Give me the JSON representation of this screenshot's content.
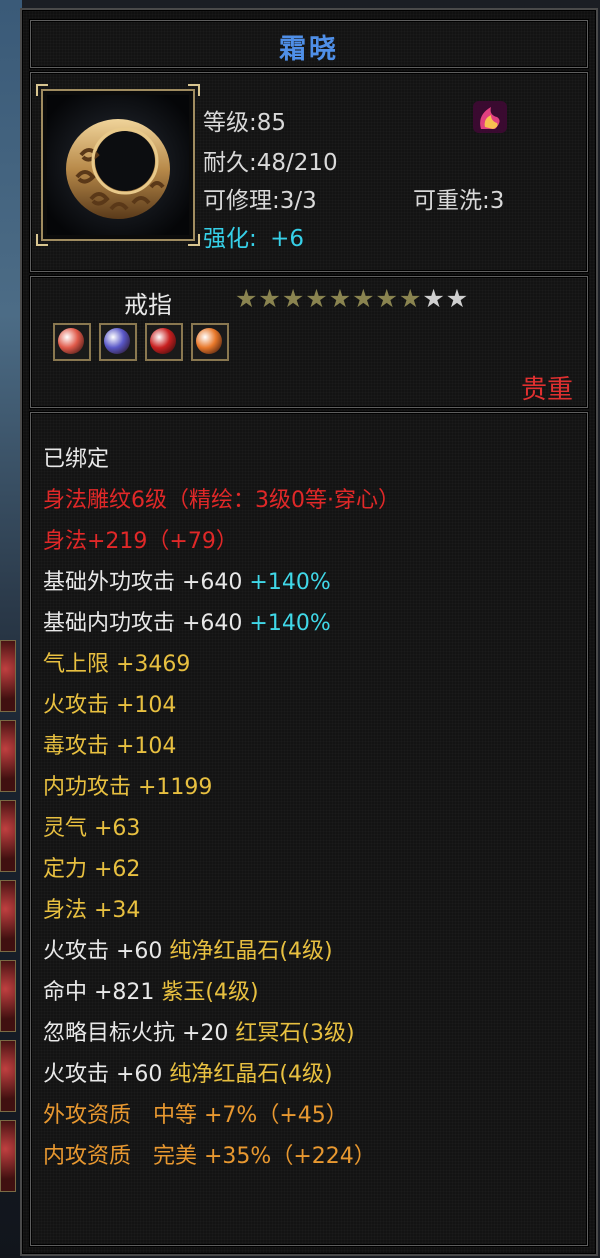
{
  "item": {
    "name": "霜晓",
    "level": "等级:85",
    "durability": "耐久:48/210",
    "repairable": "可修理:3/3",
    "rewashable": "可重洗:3",
    "enhance_label": "强化:",
    "enhance_value": "+6"
  },
  "type": {
    "label": "戒指",
    "stars_total": 10,
    "stars_filled": 8,
    "gems": [
      {
        "name": "red-gem-icon",
        "color": "#e05a4a"
      },
      {
        "name": "purple-gem-icon",
        "color": "#5a58c8"
      },
      {
        "name": "crimson-gem-icon",
        "color": "#c82020"
      },
      {
        "name": "orange-gem-icon",
        "color": "#e8782a"
      }
    ],
    "rarity": "贵重"
  },
  "attributes": [
    {
      "color": "white",
      "main": "已绑定",
      "extra": ""
    },
    {
      "color": "red",
      "main": "身法雕纹6级（精绘：3级0等·穿心）",
      "extra": ""
    },
    {
      "color": "red",
      "main": "身法+219（+79）",
      "extra": ""
    },
    {
      "color": "white",
      "main": "基础外功攻击 +640 ",
      "extra": "+140%"
    },
    {
      "color": "white",
      "main": "基础内功攻击 +640 ",
      "extra": "+140%"
    },
    {
      "color": "gold",
      "main": "气上限 +3469",
      "extra": ""
    },
    {
      "color": "gold",
      "main": "火攻击 +104",
      "extra": ""
    },
    {
      "color": "gold",
      "main": "毒攻击 +104",
      "extra": ""
    },
    {
      "color": "gold",
      "main": "内功攻击 +1199",
      "extra": ""
    },
    {
      "color": "gold",
      "main": "灵气 +63",
      "extra": ""
    },
    {
      "color": "gold",
      "main": "定力 +62",
      "extra": ""
    },
    {
      "color": "gold",
      "main": "身法 +34",
      "extra": ""
    },
    {
      "color": "white",
      "main": "火攻击 +60 ",
      "extra": "纯净红晶石(4级)"
    },
    {
      "color": "white",
      "main": "命中 +821 ",
      "extra": "紫玉(4级)"
    },
    {
      "color": "white",
      "main": "忽略目标火抗 +20 ",
      "extra": "红冥石(3级)"
    },
    {
      "color": "white",
      "main": "火攻击 +60 ",
      "extra": "纯净红晶石(4级)"
    },
    {
      "color": "orange",
      "main": "外攻资质　中等 +7%（+45）",
      "extra": ""
    },
    {
      "color": "orange",
      "main": "内攻资质　完美 +35%（+224）",
      "extra": ""
    }
  ],
  "colors": {
    "title": "#4f8fe8",
    "enhance": "#36d0e8",
    "rarity": "#e03030",
    "star_filled": "#8a8450",
    "star_empty": "#cfcfcf"
  }
}
